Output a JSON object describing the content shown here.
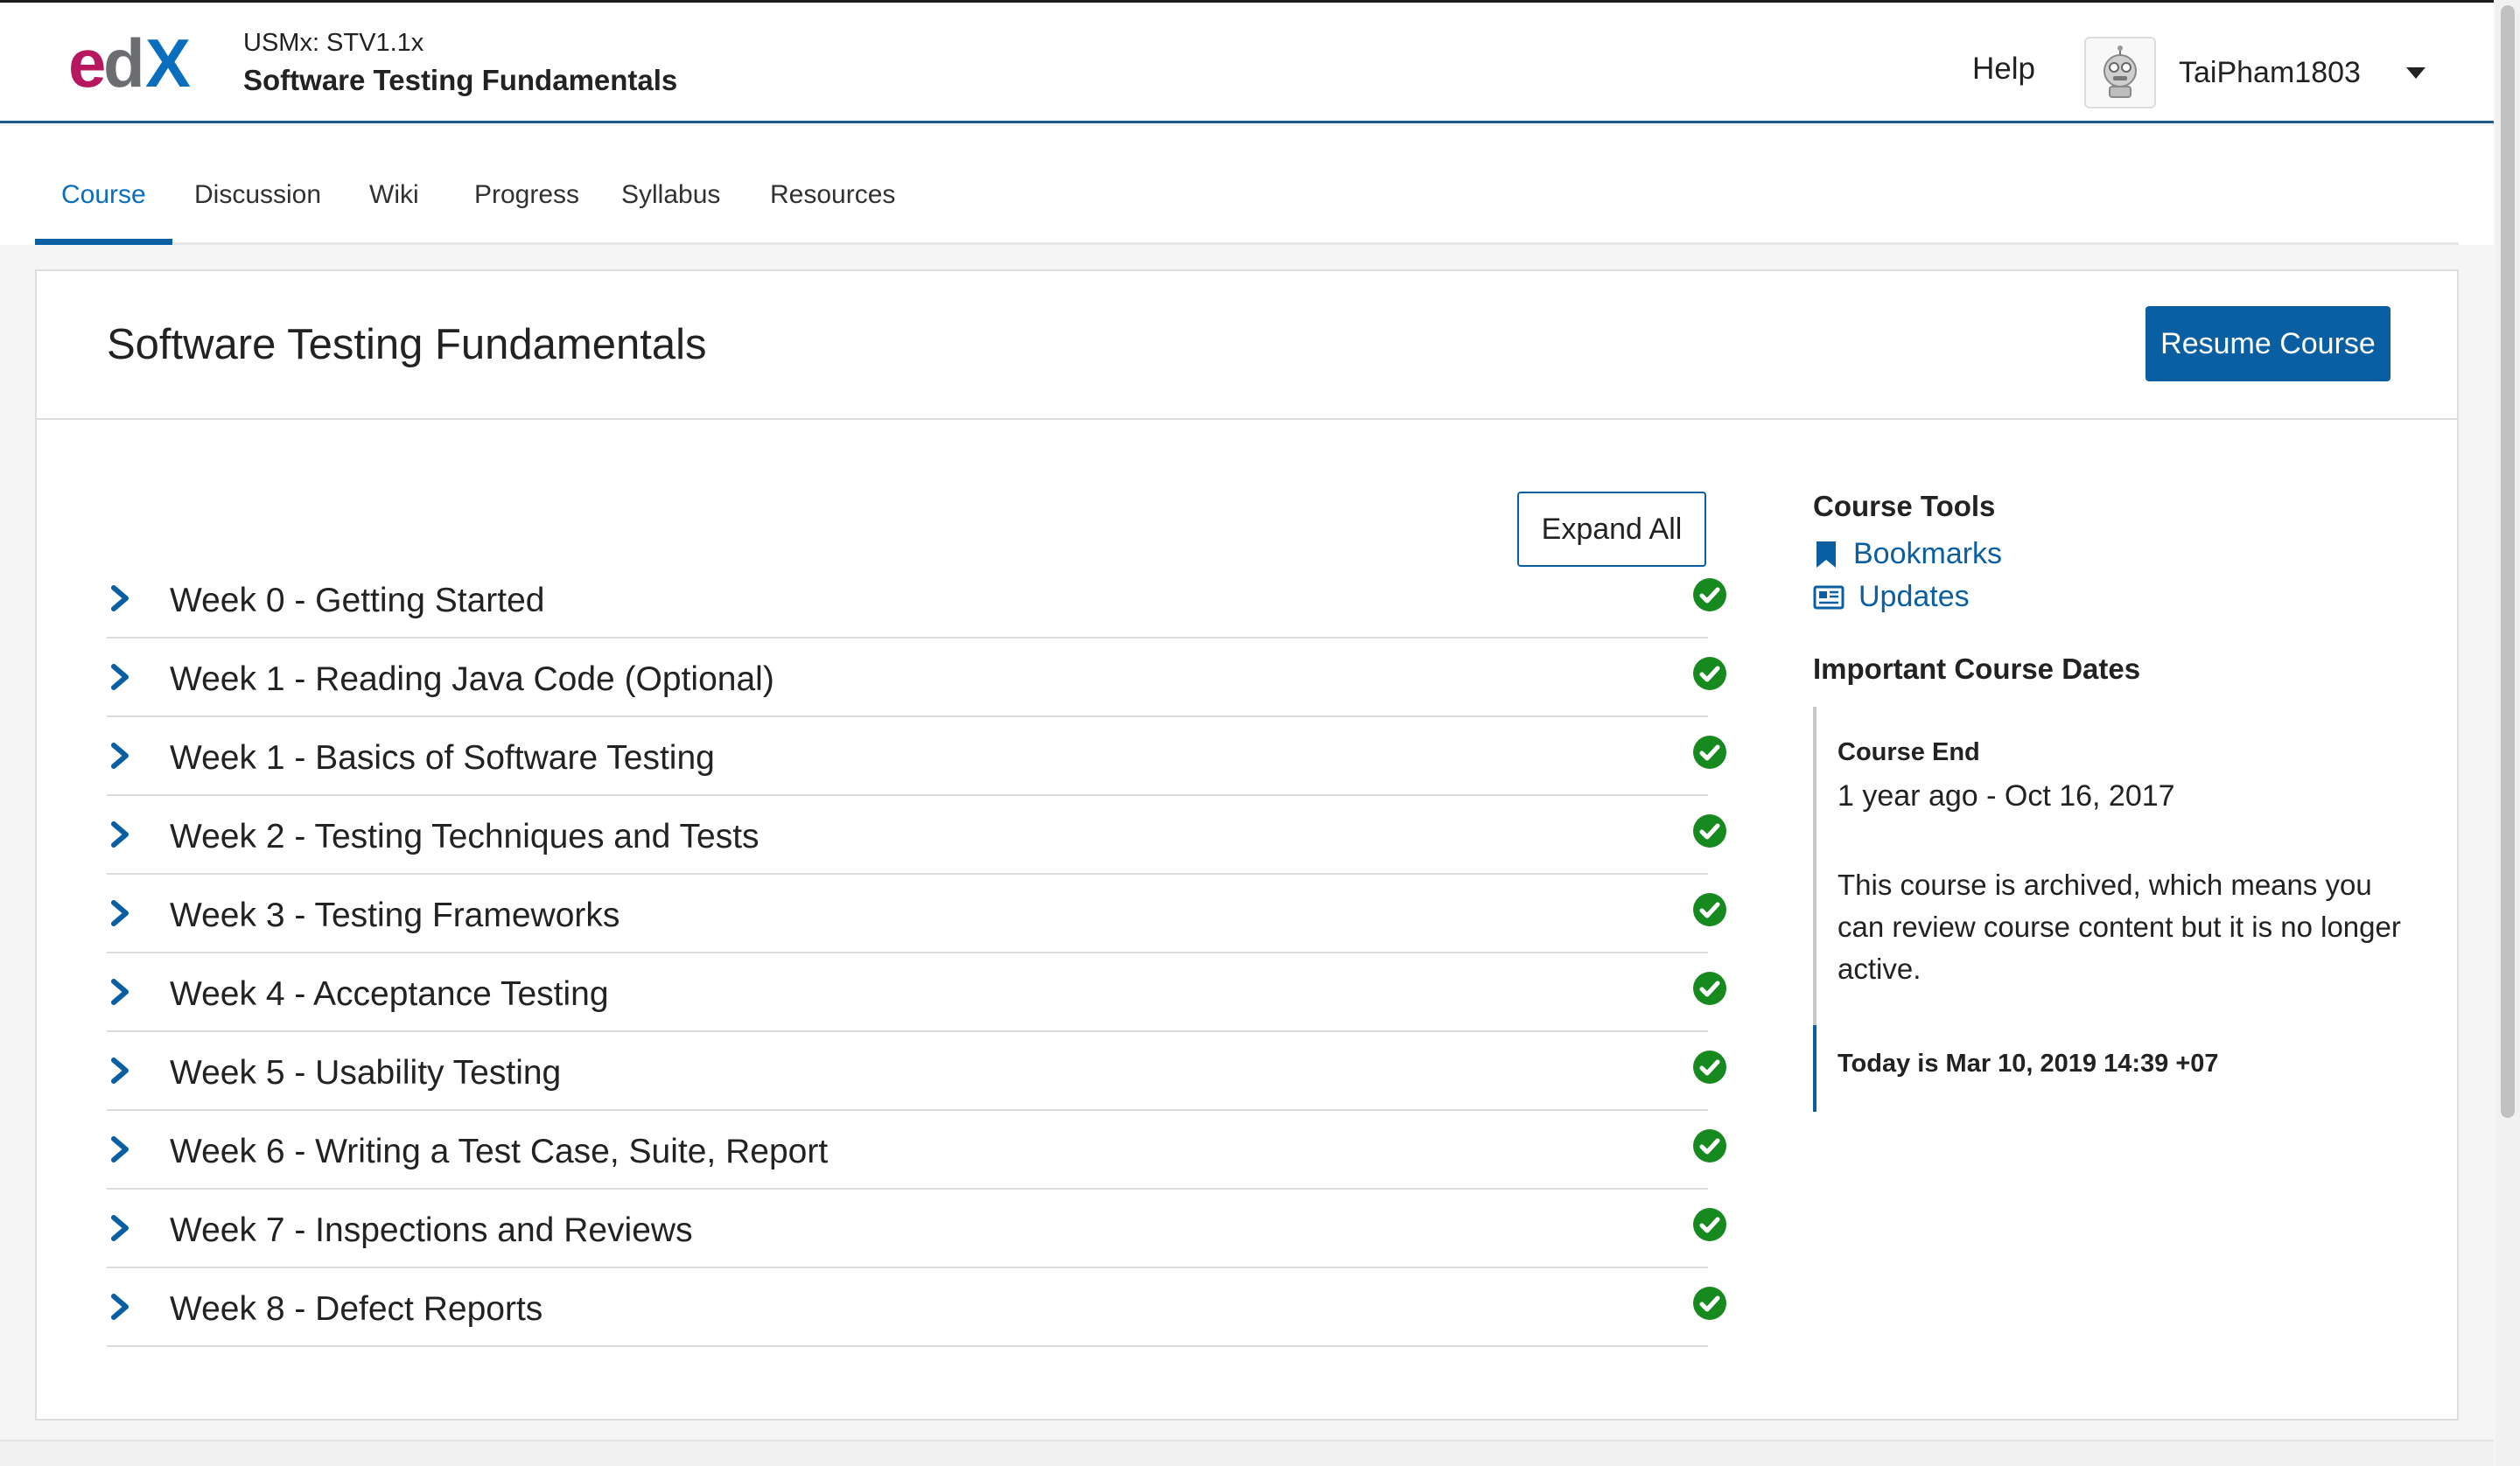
{
  "header": {
    "course_org": "USMx: STV1.1x",
    "course_name": "Software Testing Fundamentals",
    "help_label": "Help",
    "username": "TaiPham1803",
    "brand_colors": {
      "logo_e": "#b6175f",
      "logo_x": "#0a6ebd",
      "accent": "#0a5fa3"
    }
  },
  "tabs": [
    {
      "label": "Course",
      "active": true
    },
    {
      "label": "Discussion",
      "active": false
    },
    {
      "label": "Wiki",
      "active": false
    },
    {
      "label": "Progress",
      "active": false
    },
    {
      "label": "Syllabus",
      "active": false
    },
    {
      "label": "Resources",
      "active": false
    }
  ],
  "main": {
    "title": "Software Testing Fundamentals",
    "resume_label": "Resume Course",
    "expand_label": "Expand All",
    "weeks": [
      {
        "title": "Week 0 - Getting Started",
        "completed": true
      },
      {
        "title": "Week 1 - Reading Java Code (Optional)",
        "completed": true
      },
      {
        "title": "Week 1 - Basics of Software Testing",
        "completed": true
      },
      {
        "title": "Week 2 - Testing Techniques and Tests",
        "completed": true
      },
      {
        "title": "Week 3 - Testing Frameworks",
        "completed": true
      },
      {
        "title": "Week 4 - Acceptance Testing",
        "completed": true
      },
      {
        "title": "Week 5 - Usability Testing",
        "completed": true
      },
      {
        "title": "Week 6 - Writing a Test Case, Suite, Report",
        "completed": true
      },
      {
        "title": "Week 7 - Inspections and Reviews",
        "completed": true
      },
      {
        "title": "Week 8 - Defect Reports",
        "completed": true
      }
    ]
  },
  "sidebar": {
    "tools_heading": "Course Tools",
    "tools": [
      {
        "label": "Bookmarks",
        "icon": "bookmark-icon"
      },
      {
        "label": "Updates",
        "icon": "newspaper-icon"
      }
    ],
    "dates_heading": "Important Course Dates",
    "course_end_label": "Course End",
    "course_end_value": "1 year ago - Oct 16, 2017",
    "archived_text": "This course is archived, which means you can review course content but it is no longer active.",
    "today_text": "Today is Mar 10, 2019 14:39 +07"
  }
}
